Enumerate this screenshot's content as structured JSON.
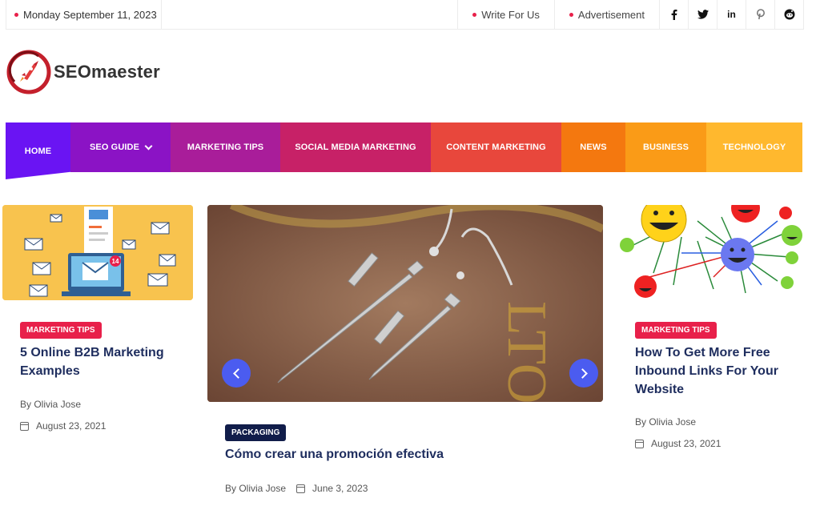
{
  "topbar": {
    "date": "Monday September 11, 2023",
    "links": [
      "Write For Us",
      "Advertisement"
    ],
    "social_icons": [
      {
        "name": "facebook-icon",
        "glyph": "f"
      },
      {
        "name": "twitter-icon",
        "glyph": "🐦"
      },
      {
        "name": "linkedin-icon",
        "glyph": "in"
      },
      {
        "name": "pinterest-icon",
        "glyph": "℗"
      },
      {
        "name": "reddit-icon",
        "glyph": "●"
      }
    ]
  },
  "logo": {
    "name": "SEOmaester"
  },
  "nav": {
    "items": [
      {
        "label": "HOME",
        "color": "#6a14f3"
      },
      {
        "label": "SEO GUIDE",
        "color": "#8b13c5",
        "dropdown": true
      },
      {
        "label": "MARKETING TIPS",
        "color": "#a91d9a"
      },
      {
        "label": "SOCIAL MEDIA MARKETING",
        "color": "#c72167"
      },
      {
        "label": "CONTENT MARKETING",
        "color": "#e8473c"
      },
      {
        "label": "NEWS",
        "color": "#f4780f"
      },
      {
        "label": "BUSINESS",
        "color": "#fa9b17"
      },
      {
        "label": "TECHNOLOGY",
        "color": "#ffb82e"
      }
    ]
  },
  "cards": {
    "left": {
      "category": "MARKETING TIPS",
      "title": "5 Online B2B Marketing Examples",
      "author": "By Olivia Jose",
      "date": "August 23, 2021"
    },
    "center": {
      "category": "PACKAGING",
      "title": "Cómo crear una promoción efectiva",
      "author": "By Olivia Jose",
      "date": "June 3, 2023"
    },
    "right": {
      "category": "MARKETING TIPS",
      "title": "How To Get More Free Inbound Links For Your Website",
      "author": "By Olivia Jose",
      "date": "August 23, 2021"
    }
  },
  "colors": {
    "badge_red": "#e8204a",
    "badge_navy": "#111d4a",
    "title_navy": "#1e2d5e",
    "arrow_blue": "#4b5cf0"
  }
}
